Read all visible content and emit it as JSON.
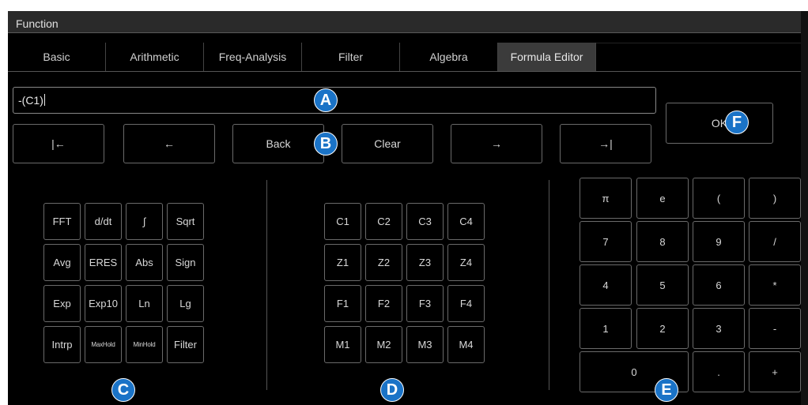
{
  "window": {
    "title": "Function"
  },
  "tabs": [
    "Basic",
    "Arithmetic",
    "Freq-Analysis",
    "Filter",
    "Algebra",
    "Formula Editor"
  ],
  "active_tab": "Formula Editor",
  "formula": {
    "value": "-(C1)"
  },
  "nav_buttons": [
    "|←",
    "←",
    "Back",
    "Clear",
    "→",
    "→|"
  ],
  "ok_label": "OK",
  "function_keys": [
    [
      "FFT",
      "d/dt",
      "∫",
      "Sqrt"
    ],
    [
      "Avg",
      "ERES",
      "Abs",
      "Sign"
    ],
    [
      "Exp",
      "Exp10",
      "Ln",
      "Lg"
    ],
    [
      "Intrp",
      "MaxHold",
      "MinHold",
      "Filter"
    ]
  ],
  "source_keys": [
    [
      "C1",
      "C2",
      "C3",
      "C4"
    ],
    [
      "Z1",
      "Z2",
      "Z3",
      "Z4"
    ],
    [
      "F1",
      "F2",
      "F3",
      "F4"
    ],
    [
      "M1",
      "M2",
      "M3",
      "M4"
    ]
  ],
  "numpad_keys": [
    [
      "π",
      "e",
      "(",
      ")"
    ],
    [
      "7",
      "8",
      "9",
      "/"
    ],
    [
      "4",
      "5",
      "6",
      "*"
    ],
    [
      "1",
      "2",
      "3",
      "-"
    ],
    [
      "0",
      ".",
      "+"
    ]
  ],
  "callouts": [
    "A",
    "B",
    "C",
    "D",
    "E",
    "F"
  ],
  "colors": {
    "badge": "#1a73c7",
    "active_tab": "#3b3b3b",
    "background": "#000000"
  }
}
